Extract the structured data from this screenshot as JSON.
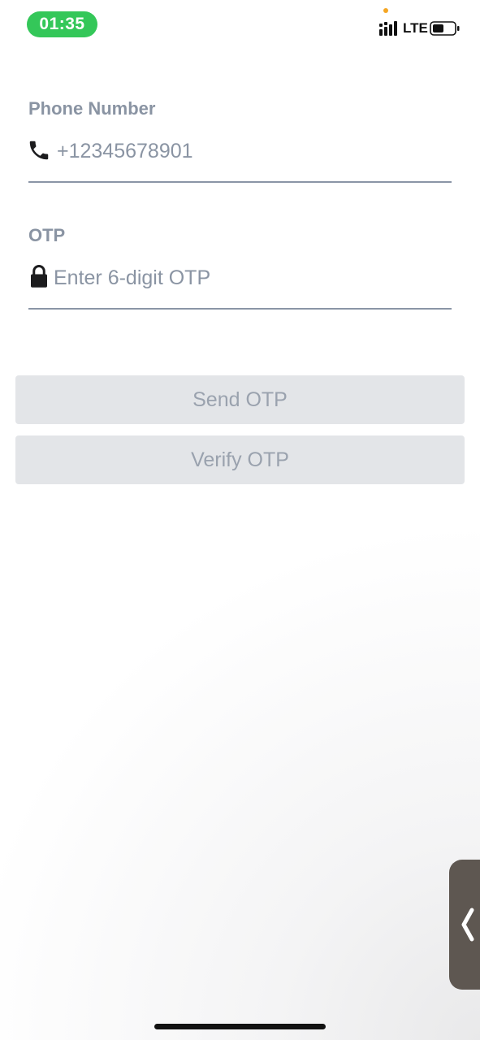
{
  "status_bar": {
    "time": "01:35",
    "network": "LTE",
    "icons": [
      "signal-icon",
      "battery-icon"
    ]
  },
  "form": {
    "phone": {
      "label": "Phone Number",
      "value": "+12345678901",
      "icon": "phone-icon"
    },
    "otp": {
      "label": "OTP",
      "value": "",
      "placeholder": "Enter 6-digit OTP",
      "icon": "lock-icon"
    }
  },
  "buttons": {
    "send_label": "Send OTP",
    "verify_label": "Verify OTP"
  },
  "side_tab": {
    "icon": "chevron-left-icon"
  },
  "colors": {
    "status_pill": "#34c759",
    "label_text": "#8a94a3",
    "button_bg": "#e3e5e8",
    "button_text": "#9aa2ae",
    "side_tab": "#5e5751"
  }
}
